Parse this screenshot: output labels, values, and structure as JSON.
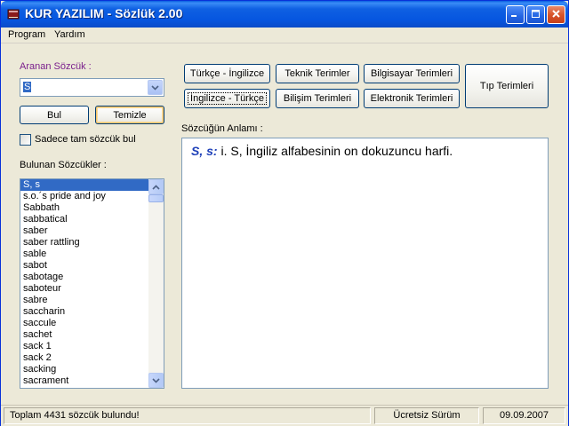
{
  "window": {
    "title": "KUR YAZILIM - Sözlük 2.00"
  },
  "menu": {
    "program": "Program",
    "help": "Yardım"
  },
  "search": {
    "label": "Aranan Sözcük :",
    "value": "S",
    "find_button": "Bul",
    "clear_button": "Temizle",
    "exact_match_label": "Sadece tam sözcük bul",
    "exact_match_checked": false
  },
  "results": {
    "label": "Bulunan Sözcükler :",
    "items": [
      "S, s",
      "s.o.´s pride and joy",
      "Sabbath",
      "sabbatical",
      "saber",
      "saber rattling",
      "sable",
      "sabot",
      "sabotage",
      "saboteur",
      "sabre",
      "saccharin",
      "saccule",
      "sachet",
      "sack 1",
      "sack 2",
      "sacking",
      "sacrament"
    ],
    "selected_index": 0
  },
  "dictionaries": {
    "tr_en": "Türkçe - İngilizce",
    "en_tr": "İngilizce - Türkçe",
    "technical": "Teknik Terimler",
    "informatics": "Bilişim Terimleri",
    "computer": "Bilgisayar Terimleri",
    "electronic": "Elektronik Terimleri",
    "medical": "Tıp Terimleri"
  },
  "meaning": {
    "label": "Sözcüğün Anlamı :",
    "headword": "S, s:",
    "definition": " i. S, İngiliz alfabesinin on dokuzuncu harfi."
  },
  "status": {
    "count_text": "Toplam 4431 sözcük bulundu!",
    "license": "Ücretsiz Sürüm",
    "date": "09.09.2007"
  },
  "colors": {
    "titlebar": "#0656e0",
    "selection": "#316ac5",
    "label_accent": "#7a1f8c",
    "headword": "#1d3fb8"
  }
}
